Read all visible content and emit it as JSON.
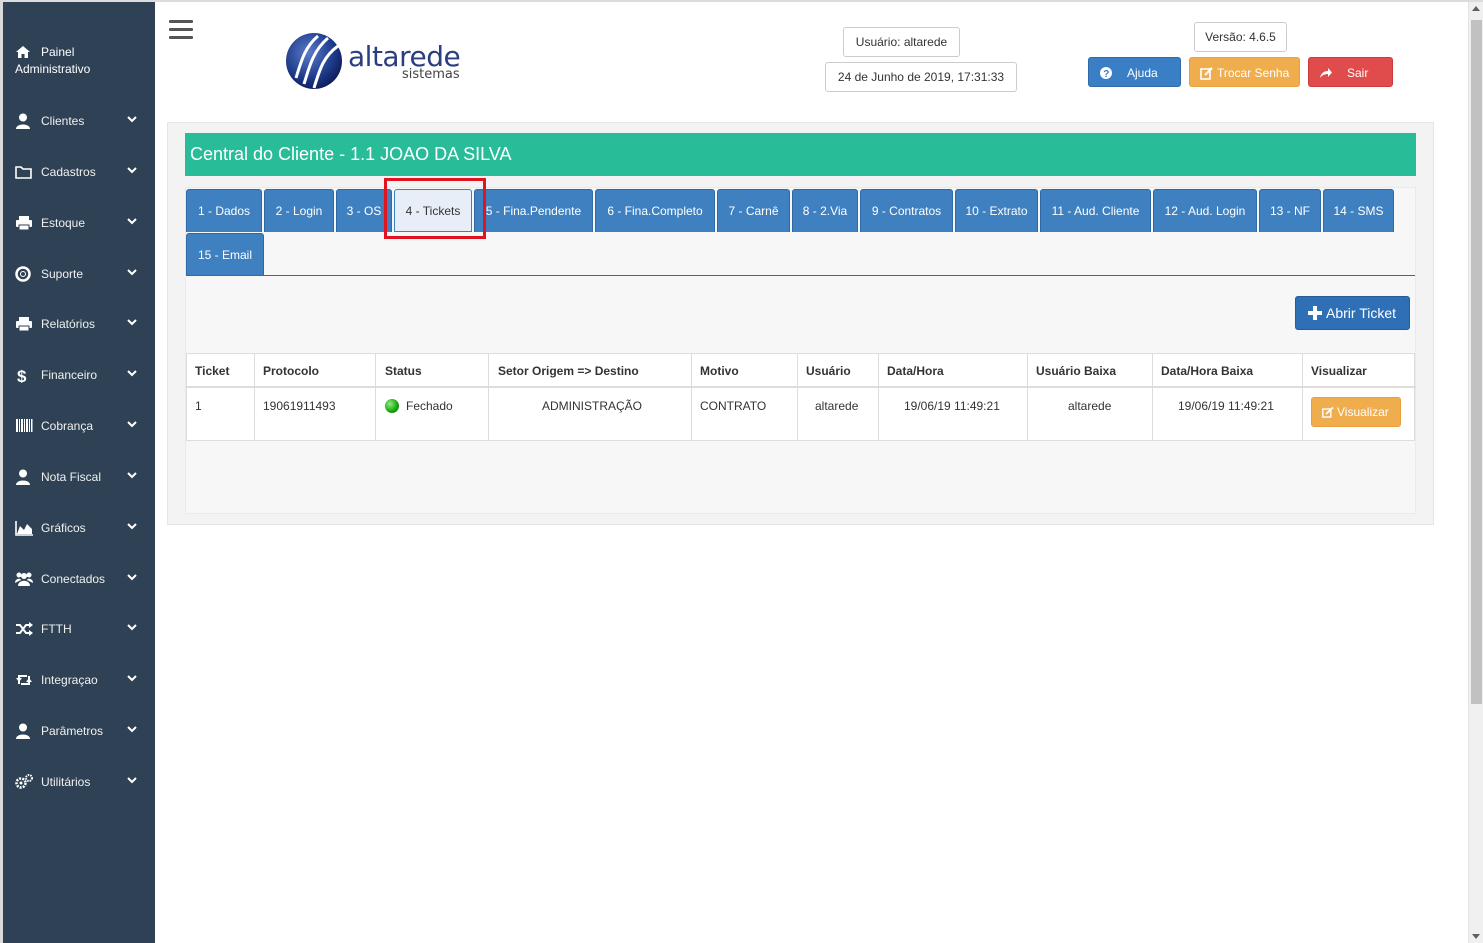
{
  "sidebar": {
    "brand_line1": "Painel",
    "brand_line2": "Administrativo",
    "items": [
      {
        "label": "Clientes",
        "icon": "user-icon"
      },
      {
        "label": "Cadastros",
        "icon": "folder-icon"
      },
      {
        "label": "Estoque",
        "icon": "printer-icon"
      },
      {
        "label": "Suporte",
        "icon": "lifebuoy-icon"
      },
      {
        "label": "Relatórios",
        "icon": "printer-icon"
      },
      {
        "label": "Financeiro",
        "icon": "dollar-icon"
      },
      {
        "label": "Cobrança",
        "icon": "barcode-icon"
      },
      {
        "label": "Nota Fiscal",
        "icon": "user-icon"
      },
      {
        "label": "Gráficos",
        "icon": "area-chart-icon"
      },
      {
        "label": "Conectados",
        "icon": "users-icon"
      },
      {
        "label": "FTTH",
        "icon": "shuffle-icon"
      },
      {
        "label": "Integraçao",
        "icon": "retweet-icon"
      },
      {
        "label": "Parâmetros",
        "icon": "user-icon"
      },
      {
        "label": "Utilitários",
        "icon": "gears-icon"
      }
    ]
  },
  "header": {
    "logo_main": "altarede",
    "logo_sub": "sistemas",
    "user": "Usuário: altarede",
    "datetime": "24 de Junho de 2019, 17:31:33",
    "version": "Versão: 4.6.5",
    "help_label": "Ajuda",
    "change_password_label": "Trocar Senha",
    "logout_label": "Sair"
  },
  "colors": {
    "sidebar_bg": "#2f4255",
    "title_bar": "#28bc99",
    "tab_blue": "#3f80c1",
    "help_btn": "#3a7fc6",
    "change_pw_btn": "#f0ad4e",
    "logout_btn": "#e04b4b",
    "highlight": "#e0141e"
  },
  "page": {
    "title": "Central do Cliente - 1.1 JOAO DA SILVA",
    "tabs": [
      "1 - Dados",
      "2 - Login",
      "3 - OS",
      "4 - Tickets",
      "5 - Fina.Pendente",
      "6 - Fina.Completo",
      "7 - Carnê",
      "8 - 2.Via",
      "9 - Contratos",
      "10 - Extrato",
      "11 - Aud. Cliente",
      "12 - Aud. Login",
      "13 - NF",
      "14 - SMS",
      "15 - Email"
    ],
    "active_tab": "4 - Tickets",
    "open_ticket_label": "Abrir Ticket"
  },
  "table": {
    "headers": [
      "Ticket",
      "Protocolo",
      "Status",
      "Setor Origem => Destino",
      "Motivo",
      "Usuário",
      "Data/Hora",
      "Usuário Baixa",
      "Data/Hora Baixa",
      "Visualizar"
    ],
    "rows": [
      {
        "ticket": "1",
        "protocolo": "19061911493",
        "status": "Fechado",
        "setor": "ADMINISTRAÇÃO",
        "motivo": "CONTRATO",
        "usuario": "altarede",
        "data_hora": "19/06/19 11:49:21",
        "usuario_baixa": "altarede",
        "data_hora_baixa": "19/06/19 11:49:21",
        "visualizar_label": "Visualizar"
      }
    ]
  }
}
